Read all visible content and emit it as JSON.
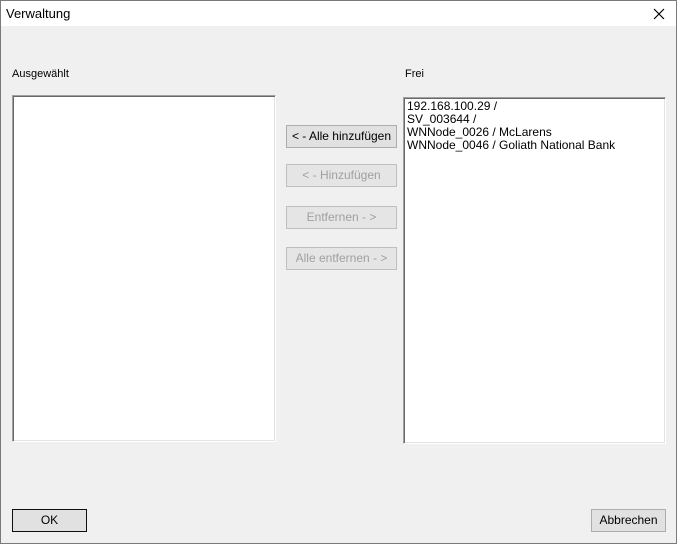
{
  "window": {
    "title": "Verwaltung"
  },
  "left_panel": {
    "label": "Ausgewählt",
    "items": []
  },
  "right_panel": {
    "label": "Frei",
    "items": [
      "192.168.100.29 /",
      "SV_003644 /",
      "WNNode_0026 / McLarens",
      "WNNode_0046 / Goliath National Bank"
    ]
  },
  "buttons": {
    "add_all": "< -  Alle hinzufügen",
    "add": "< - Hinzufügen",
    "remove": "Entfernen - >",
    "remove_all": "Alle entfernen - >",
    "ok": "OK",
    "cancel": "Abbrechen"
  }
}
